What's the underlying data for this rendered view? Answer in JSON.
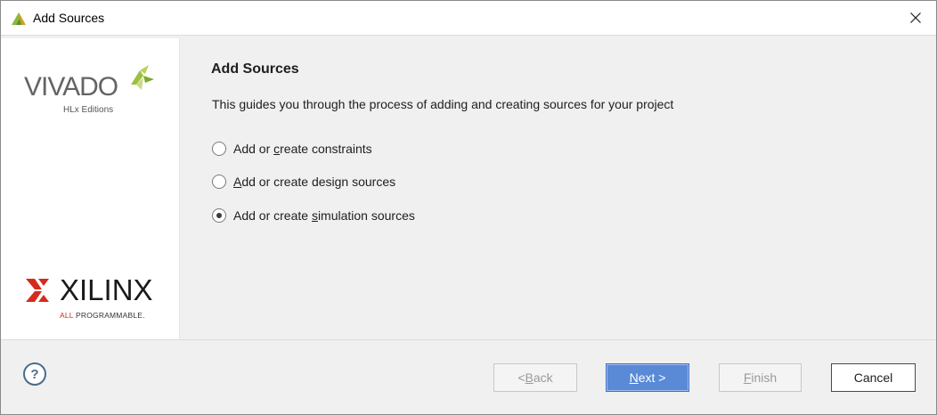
{
  "window": {
    "title": "Add Sources",
    "close_icon": "close-icon"
  },
  "branding": {
    "vivado": "VIVADO",
    "vivado_edition": "HLx Editions",
    "xilinx": "XILINX",
    "xilinx_tagline_all": "ALL",
    "xilinx_tagline_rest": "PROGRAMMABLE.",
    "colors": {
      "vivado_green": "#8cb83c",
      "xilinx_red": "#d52b1e"
    }
  },
  "page": {
    "heading": "Add Sources",
    "description": "This guides you through the process of adding and creating sources for your project"
  },
  "options": [
    {
      "label_pre": "Add or ",
      "mnemonic": "c",
      "label_post": "reate constraints",
      "checked": false
    },
    {
      "label_pre": "",
      "mnemonic": "A",
      "label_post": "dd or create design sources",
      "checked": false
    },
    {
      "label_pre": "Add or create ",
      "mnemonic": "s",
      "label_post": "imulation sources",
      "checked": true
    }
  ],
  "buttons": {
    "help": "?",
    "back_pre": "< ",
    "back_mnemonic": "B",
    "back_post": "ack",
    "next_mnemonic": "N",
    "next_post": "ext >",
    "finish_mnemonic": "F",
    "finish_post": "inish",
    "cancel": "Cancel"
  }
}
